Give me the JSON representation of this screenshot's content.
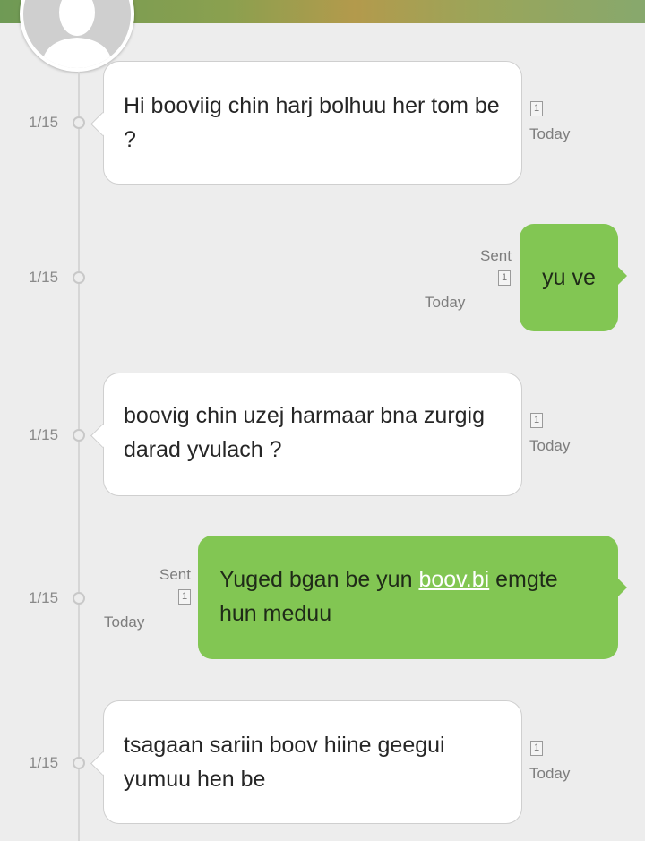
{
  "contact": {
    "avatar_icon": "person-silhouette-icon"
  },
  "messages": [
    {
      "direction": "incoming",
      "date": "1/15",
      "text": "Hi booviig chin harj bolhuu her tom be ?",
      "unread_count": "1",
      "time": "Today"
    },
    {
      "direction": "outgoing",
      "date": "1/15",
      "status": "Sent",
      "text": "yu ve",
      "count": "1",
      "time": "Today"
    },
    {
      "direction": "incoming",
      "date": "1/15",
      "text": "boovig chin uzej harmaar bna zurgig darad yvulach ?",
      "unread_count": "1",
      "time": "Today"
    },
    {
      "direction": "outgoing",
      "date": "1/15",
      "status": "Sent",
      "text_before": "Yuged bgan be yun ",
      "link_text": "boov.bi",
      "text_after": " emgte hun meduu",
      "count": "1",
      "time": "Today"
    },
    {
      "direction": "incoming",
      "date": "1/15",
      "text": "tsagaan sariin boov hiine geegui yumuu hen be",
      "unread_count": "1",
      "time": "Today"
    }
  ],
  "colors": {
    "outgoing_bubble": "#82c653",
    "incoming_bubble": "#ffffff",
    "background": "#ededed"
  }
}
